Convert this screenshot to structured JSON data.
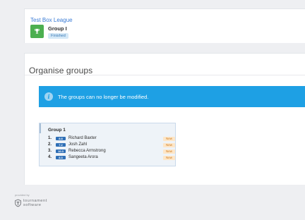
{
  "header": {
    "breadcrumb": "Test Box League",
    "group_title": "Group I",
    "status": "Finished"
  },
  "main": {
    "title": "Organise groups",
    "alert": {
      "icon": "info-icon",
      "text": "The groups can no longer be modified."
    },
    "group": {
      "name": "Group 1",
      "players": [
        {
          "num": "1.",
          "rating": "8.8",
          "name": "Richard Baxter",
          "badge": "New"
        },
        {
          "num": "2.",
          "rating": "7.2",
          "name": "Josh Zahl",
          "badge": "New"
        },
        {
          "num": "3.",
          "rating": "10.3",
          "name": "Rebecca Armstrong",
          "badge": "New"
        },
        {
          "num": "4.",
          "rating": "8.3",
          "name": "Sangeeta Arora",
          "badge": "New"
        }
      ]
    }
  },
  "footer": {
    "provided_by": "provided by",
    "brand_line1": "tournament",
    "brand_line2": "software"
  },
  "colors": {
    "accent": "#1ea0e4",
    "avatar": "#4caf50",
    "rating": "#2f6fb6"
  }
}
